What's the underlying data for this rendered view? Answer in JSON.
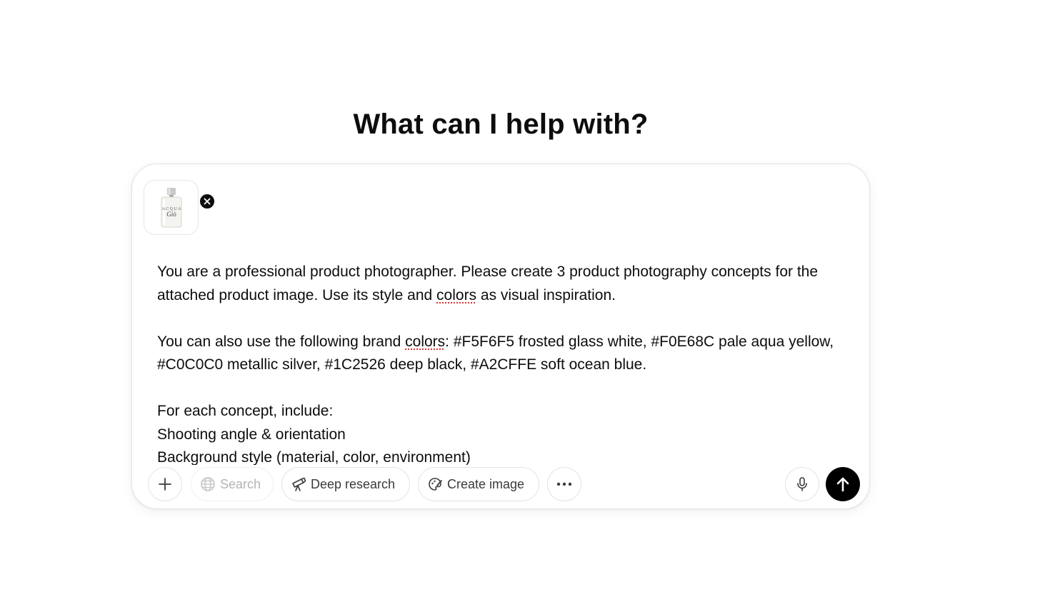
{
  "heading": "What can I help with?",
  "composer": {
    "attachment": {
      "type": "image",
      "subject": "perfume bottle",
      "remove_icon": "close-icon"
    },
    "paragraphs": [
      {
        "segments": [
          {
            "text": "You are a professional product photographer. Please create 3 product photography concepts for the attached product image. Use its style and "
          },
          {
            "text": "colors",
            "spellcheck": true
          },
          {
            "text": " as visual inspiration."
          }
        ]
      },
      {
        "segments": [
          {
            "text": "You can also use the following brand "
          },
          {
            "text": "colors",
            "spellcheck": true
          },
          {
            "text": ": #F5F6F5 frosted glass white, #F0E68C pale aqua yellow, #C0C0C0 metallic silver, #1C2526 deep black, #A2CFFE soft ocean blue."
          }
        ]
      }
    ],
    "list_intro": "For each concept, include:",
    "list_items": [
      "Shooting angle & orientation",
      "Background style (material, color, environment)"
    ]
  },
  "toolbar": {
    "attach_icon": "plus-icon",
    "search_label": "Search",
    "search_icon": "globe-icon",
    "search_disabled": true,
    "deep_research_label": "Deep research",
    "deep_research_icon": "telescope-icon",
    "create_image_label": "Create image",
    "create_image_icon": "paint-palette-icon",
    "more_icon": "more-horizontal-icon",
    "mic_icon": "microphone-icon",
    "send_icon": "arrow-up-icon"
  },
  "colors": {
    "text": "#0d0d0d",
    "border": "#e3e3e3",
    "send_button": "#000000",
    "spellcheck_underline": "#e03131",
    "disabled_text": "#b4b4b4"
  }
}
